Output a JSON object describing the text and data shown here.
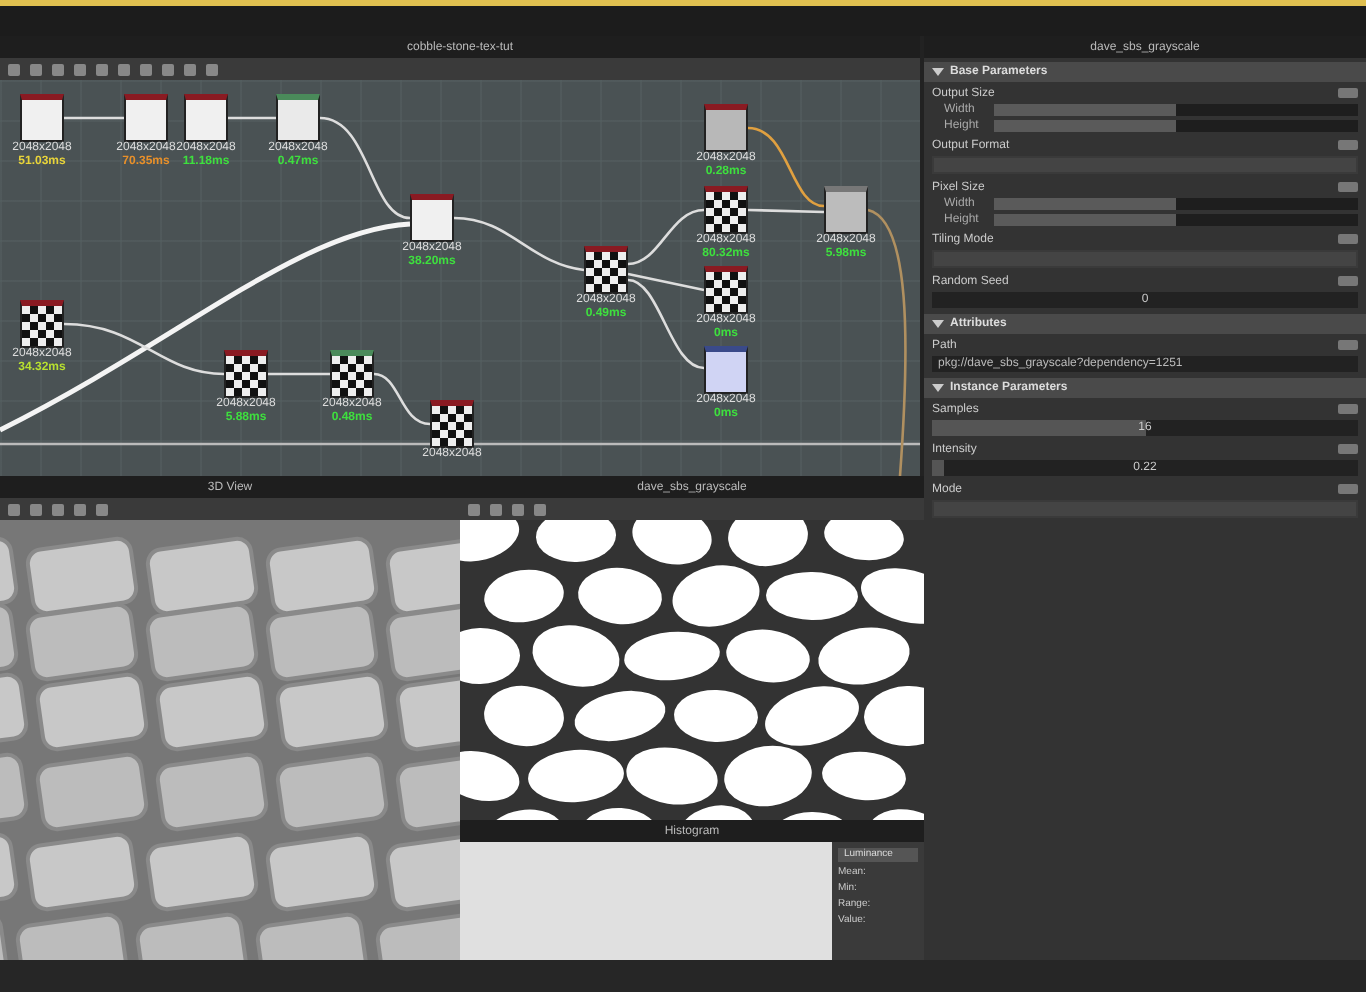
{
  "graph": {
    "title": "cobble-stone-tex-tut",
    "nodes": [
      {
        "kind": "noise",
        "size": "2048x2048",
        "time": "51.03ms",
        "color": "#e8d43a"
      },
      {
        "kind": "noise",
        "size": "2048x2048",
        "time": "70.35ms",
        "color": "#e8902a"
      },
      {
        "kind": "noise",
        "size": "2048x2048",
        "time": "11.18ms",
        "color": "#3ee03e"
      },
      {
        "kind": "filter",
        "size": "2048x2048",
        "time": "0.47ms",
        "color": "#3ee03e"
      },
      {
        "kind": "noise",
        "size": "2048x2048",
        "time": "38.20ms",
        "color": "#3ee03e"
      },
      {
        "kind": "bricks",
        "size": "2048x2048",
        "time": "34.32ms",
        "color": "#b8e030"
      },
      {
        "kind": "bricks",
        "size": "2048x2048",
        "time": "5.88ms",
        "color": "#3ee03e"
      },
      {
        "kind": "mask",
        "size": "2048x2048",
        "time": "0.48ms",
        "color": "#3ee03e"
      },
      {
        "kind": "bricks",
        "size": "2048x2048"
      },
      {
        "kind": "bricks",
        "size": "2048x2048",
        "time": "0.49ms",
        "color": "#3ee03e"
      },
      {
        "kind": "solid",
        "size": "2048x2048",
        "time": "0.28ms",
        "color": "#3ee03e"
      },
      {
        "kind": "bricks",
        "size": "2048x2048",
        "time": "80.32ms",
        "color": "#3ee03e"
      },
      {
        "kind": "bricks",
        "size": "2048x2048",
        "time": "0ms",
        "color": "#3ee03e"
      },
      {
        "kind": "normal",
        "size": "2048x2048",
        "time": "0ms",
        "color": "#3ee03e"
      },
      {
        "kind": "output",
        "size": "2048x2048",
        "time": "5.98ms",
        "color": "#3ee03e"
      }
    ]
  },
  "properties": {
    "title": "dave_sbs_grayscale",
    "sections": [
      {
        "title": "Base Parameters",
        "expanded": true,
        "params": [
          {
            "kind": "sliders",
            "label": "Output Size",
            "rows": [
              {
                "label": "Width",
                "level": 0.5
              },
              {
                "label": "Height",
                "level": 0.5
              }
            ]
          },
          {
            "kind": "dropdown",
            "label": "Output Format"
          },
          {
            "kind": "sliders",
            "label": "Pixel Size",
            "rows": [
              {
                "label": "Width",
                "level": 0.5
              },
              {
                "label": "Height",
                "level": 0.5
              }
            ]
          },
          {
            "kind": "dropdown",
            "label": "Tiling Mode"
          },
          {
            "kind": "number",
            "label": "Random Seed",
            "value": "0"
          }
        ]
      },
      {
        "title": "Attributes",
        "expanded": true,
        "params": [
          {
            "kind": "field",
            "label": "Path",
            "value": "pkg://dave_sbs_grayscale?dependency=1251"
          }
        ]
      },
      {
        "title": "Instance Parameters",
        "expanded": true,
        "params": [
          {
            "kind": "slider",
            "label": "Samples",
            "value": "16",
            "level": 0.5
          },
          {
            "kind": "slider",
            "label": "Intensity",
            "value": "0.22",
            "level": 0.03
          },
          {
            "kind": "dropdown",
            "label": "Mode"
          }
        ]
      }
    ]
  },
  "view3d": {
    "title": "3D View"
  },
  "view2d": {
    "title": "dave_sbs_grayscale"
  },
  "histogram": {
    "title": "Histogram",
    "channel": "Luminance",
    "stats": [
      "Mean:",
      "Min:",
      "Range:",
      "Value:"
    ]
  }
}
